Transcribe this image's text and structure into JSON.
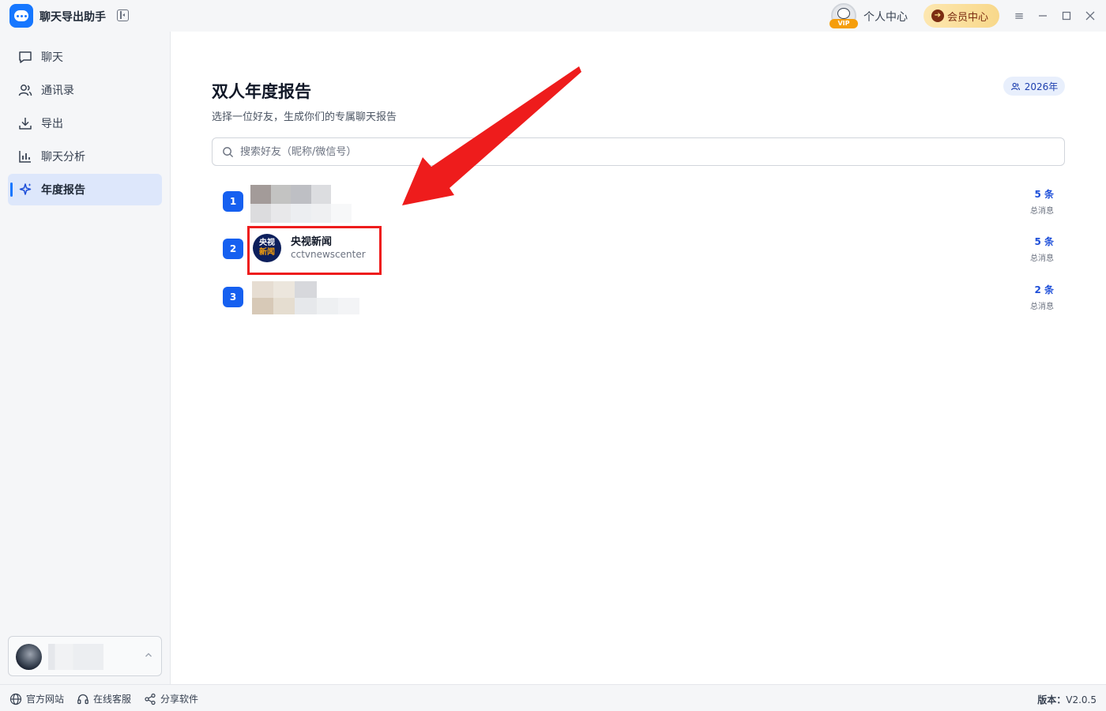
{
  "app": {
    "title": "聊天导出助手",
    "accent": "#1677ff"
  },
  "titlebar": {
    "vip_badge": "VIP",
    "personal_center": "个人中心",
    "member_center": "会员中心"
  },
  "sidebar": {
    "items": [
      {
        "label": "聊天",
        "icon": "chat-bubble-icon"
      },
      {
        "label": "通讯录",
        "icon": "contacts-icon"
      },
      {
        "label": "导出",
        "icon": "download-icon"
      },
      {
        "label": "聊天分析",
        "icon": "bar-chart-icon"
      },
      {
        "label": "年度报告",
        "icon": "sparkle-icon",
        "active": true
      }
    ]
  },
  "main": {
    "title": "双人年度报告",
    "subtitle": "选择一位好友，生成你们的专属聊天报告",
    "year_badge": "2026年",
    "search_placeholder": "搜索好友（昵称/微信号）",
    "friends": [
      {
        "rank": "1",
        "count": "5 条",
        "count_label": "总消息"
      },
      {
        "rank": "2",
        "name": "央视新闻",
        "id": "cctvnewscenter",
        "count": "5 条",
        "count_label": "总消息",
        "avatar_text": [
          "央视",
          "新闻"
        ]
      },
      {
        "rank": "3",
        "count": "2 条",
        "count_label": "总消息"
      }
    ]
  },
  "footer": {
    "website": "官方网站",
    "support": "在线客服",
    "share": "分享软件",
    "version_label": "版本：",
    "version": "V2.0.5"
  }
}
